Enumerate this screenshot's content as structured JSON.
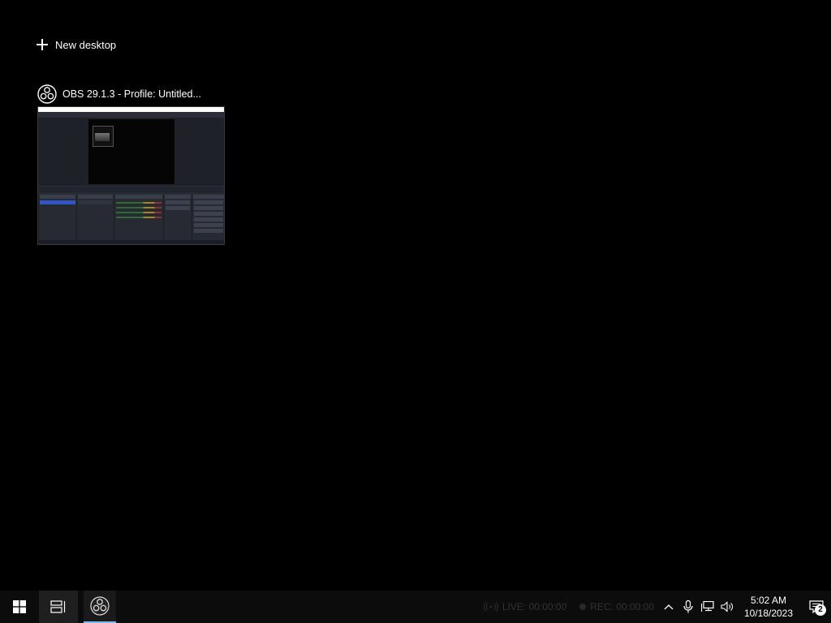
{
  "task_view": {
    "new_desktop_label": "New desktop",
    "windows": [
      {
        "title": "OBS 29.1.3 - Profile: Untitled...",
        "icon": "obs-icon"
      }
    ]
  },
  "taskbar": {
    "start_icon": "windows-logo-icon",
    "task_view_icon": "task-view-icon",
    "pinned_apps": [
      {
        "name": "OBS Studio",
        "icon": "obs-icon",
        "active": true
      }
    ],
    "obs_status": {
      "live_label": "LIVE: 00:00:00",
      "rec_label": "REC: 00:00:00"
    },
    "tray": {
      "icons": [
        "chevron-up-icon",
        "microphone-icon",
        "network-icon",
        "speaker-icon"
      ]
    },
    "clock": {
      "time": "5:02 AM",
      "date": "10/18/2023"
    },
    "notifications": {
      "icon": "action-center-icon",
      "count": "2"
    }
  },
  "colors": {
    "background": "#000000",
    "taskbar": "#0c0c0c",
    "active_indicator": "#76b9ed",
    "selection_blue": "#2f55c7"
  }
}
